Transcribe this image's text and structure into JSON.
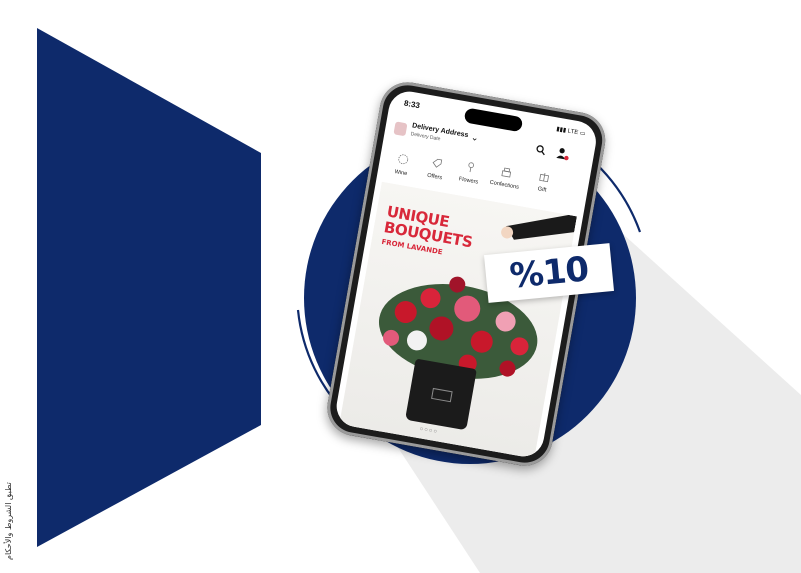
{
  "side_caption": "تطبق الشروط والأحكام",
  "phone": {
    "status_time": "8:33",
    "status_network": "LTE",
    "header": {
      "title": "Delivery Address",
      "subtitle": "Delivery Date"
    },
    "categories": [
      {
        "label": "Wine",
        "icon": "wine-icon"
      },
      {
        "label": "Offers",
        "icon": "tag-icon"
      },
      {
        "label": "Flowers",
        "icon": "flower-icon"
      },
      {
        "label": "Confections",
        "icon": "cake-icon"
      },
      {
        "label": "Gift",
        "icon": "gift-icon"
      }
    ],
    "banner": {
      "headline_line1": "UNIQUE",
      "headline_line2": "BOUQUETS",
      "subline": "FROM LAVANDE",
      "pager": "○○○○"
    }
  },
  "discount": "%10",
  "colors": {
    "navy": "#0e2a6b",
    "shadow_gray": "#ececec",
    "accent_red": "#d8283a"
  }
}
